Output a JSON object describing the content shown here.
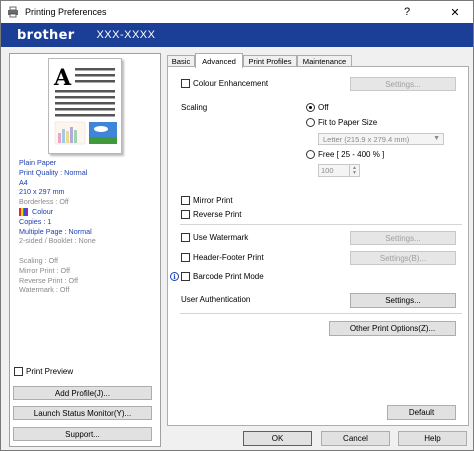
{
  "window": {
    "title": "Printing Preferences"
  },
  "banner": {
    "brand": "brother",
    "model": "XXX-XXXX"
  },
  "titlebar": {
    "help": "?",
    "close": "✕"
  },
  "tabs": [
    "Basic",
    "Advanced",
    "Print Profiles",
    "Maintenance"
  ],
  "summary": {
    "paper": "Plain Paper",
    "quality": "Print Quality : Normal",
    "size": "A4",
    "dims": "210 x 297 mm",
    "borderless": "Borderless : Off",
    "colour": "Colour",
    "copies": "Copies : 1",
    "multiple": "Multiple Page : Normal",
    "twosided": "2-sided / Booklet : None",
    "scaling": "Scaling : Off",
    "mirror": "Mirror Print : Off",
    "reverse": "Reverse Print : Off",
    "watermark": "Watermark : Off"
  },
  "left": {
    "print_preview": "Print Preview",
    "add_profile": "Add Profile(J)...",
    "launch_status": "Launch Status Monitor(Y)...",
    "support": "Support..."
  },
  "advanced": {
    "colour_enhancement": "Colour Enhancement",
    "colour_settings": "Settings...",
    "scaling_label": "Scaling",
    "off": "Off",
    "fit_to_paper": "Fit to Paper Size",
    "paper_size": "Letter (215.9 x 279.4 mm)",
    "free": "Free [ 25 - 400 % ]",
    "free_value": "100",
    "mirror_print": "Mirror Print",
    "reverse_print": "Reverse Print",
    "use_watermark": "Use Watermark",
    "watermark_settings": "Settings...",
    "header_footer": "Header-Footer Print",
    "header_settings": "Settings(B)...",
    "barcode": "Barcode Print Mode",
    "user_auth": "User Authentication",
    "user_auth_settings": "Settings...",
    "other_options": "Other Print Options(Z)...",
    "default": "Default"
  },
  "footer": {
    "ok": "OK",
    "cancel": "Cancel",
    "help": "Help"
  },
  "colors": {
    "banner": "#1b3e96",
    "summary_text": "#1b3fb2",
    "disabled": "#a0a0a0"
  }
}
